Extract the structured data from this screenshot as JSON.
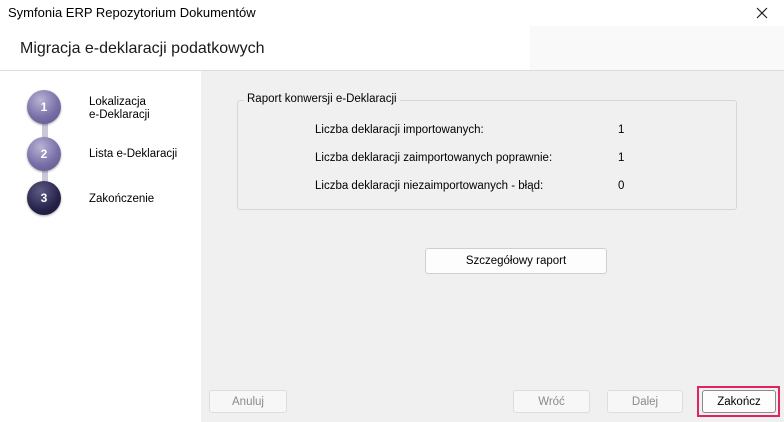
{
  "window": {
    "title": "Symfonia ERP Repozytorium Dokumentów"
  },
  "header": {
    "title": "Migracja e-deklaracji podatkowych"
  },
  "steps": [
    {
      "number": "1",
      "label_line1": "Lokalizacja",
      "label_line2": "e-Deklaracji"
    },
    {
      "number": "2",
      "label_line1": "Lista e-Deklaracji"
    },
    {
      "number": "3",
      "label_line1": "Zakończenie"
    }
  ],
  "report": {
    "legend": "Raport konwersji e-Deklaracji",
    "rows": [
      {
        "label": "Liczba deklaracji importowanych:",
        "value": "1"
      },
      {
        "label": "Liczba deklaracji zaimportowanych poprawnie:",
        "value": "1"
      },
      {
        "label": "Liczba deklaracji niezaimportowanych - błąd:",
        "value": "0"
      }
    ],
    "details_button": "Szczegółowy raport"
  },
  "footer": {
    "cancel": "Anuluj",
    "back": "Wróć",
    "next": "Dalej",
    "finish": "Zakończ"
  },
  "icons": {
    "close": "close-icon"
  },
  "colors": {
    "highlight": "#e0245e",
    "active_step": "#26234a",
    "step": "#7a70a8"
  }
}
